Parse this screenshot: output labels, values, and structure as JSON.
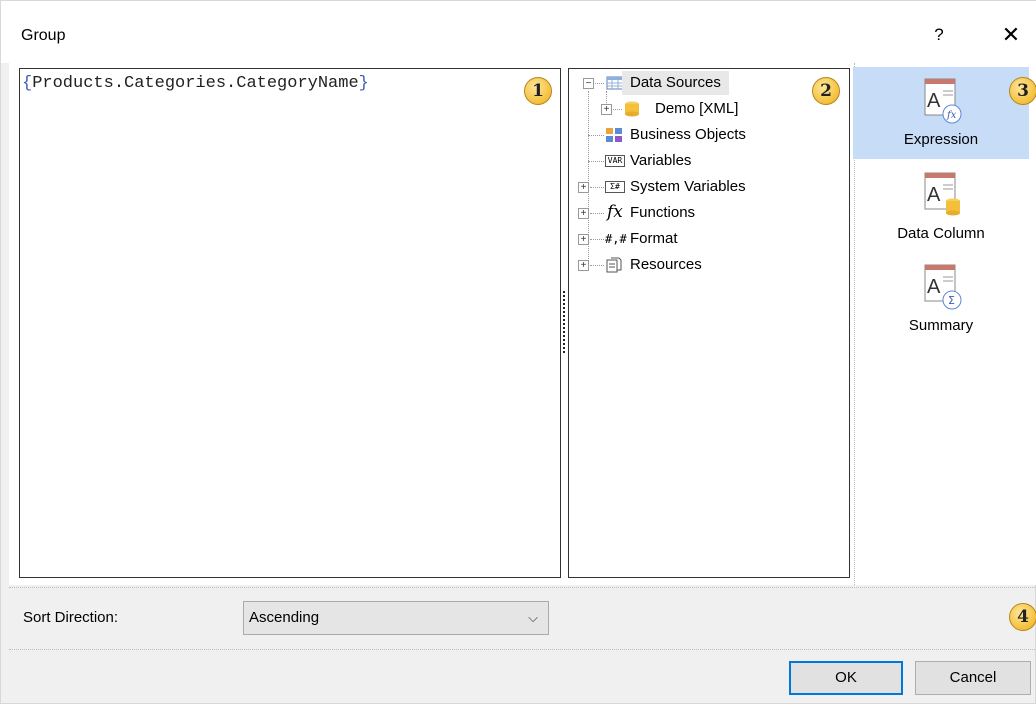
{
  "window": {
    "title": "Group",
    "help": "?",
    "close": "✕"
  },
  "editor": {
    "open_brace": "{",
    "expression": "Products.Categories.CategoryName",
    "close_brace": "}"
  },
  "badges": [
    "1",
    "2",
    "3",
    "4"
  ],
  "tree": {
    "items": [
      {
        "label": "Data Sources",
        "icon": "data-sources-icon",
        "expander": "−",
        "selected": true
      },
      {
        "label": "Demo [XML]",
        "icon": "database-icon",
        "expander": "+"
      },
      {
        "label": "Business Objects",
        "icon": "business-objects-icon"
      },
      {
        "label": "Variables",
        "icon": "variables-icon",
        "glyph": "VAR"
      },
      {
        "label": "System Variables",
        "icon": "system-variables-icon",
        "glyph": "Σ#",
        "expander": "+"
      },
      {
        "label": "Functions",
        "icon": "function-icon",
        "glyph": "fx",
        "expander": "+"
      },
      {
        "label": "Format",
        "icon": "format-icon",
        "glyph": "#,#",
        "expander": "+"
      },
      {
        "label": "Resources",
        "icon": "resources-icon",
        "expander": "+"
      }
    ]
  },
  "side": {
    "items": [
      {
        "label": "Expression",
        "icon": "expression-icon",
        "active": true
      },
      {
        "label": "Data Column",
        "icon": "data-column-icon"
      },
      {
        "label": "Summary",
        "icon": "summary-icon"
      }
    ]
  },
  "sort": {
    "label": "Sort Direction:",
    "value": "Ascending",
    "chevron": "⌵"
  },
  "buttons": {
    "ok": "OK",
    "cancel": "Cancel"
  },
  "colors": {
    "selection": "#c6dcf7",
    "badge": "#f4bf3a",
    "accent": "#0078d7",
    "brace": "#3c5ab9"
  }
}
